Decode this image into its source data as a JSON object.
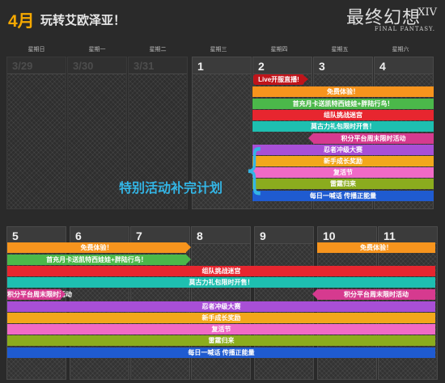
{
  "header": {
    "month": "4月",
    "subtitle": "玩转艾欧泽亚！",
    "logo_main": "最终幻想",
    "logo_numeral": "XIV",
    "logo_sub": "FINAL FANTASY."
  },
  "weekdays": [
    "星期日",
    "星期一",
    "星期二",
    "星期三",
    "星期四",
    "星期五",
    "星期六"
  ],
  "week1_days": [
    "3/29",
    "3/30",
    "3/31",
    "1",
    "2",
    "3",
    "4"
  ],
  "week2_days": [
    "5",
    "6",
    "7",
    "8",
    "9",
    "10",
    "11"
  ],
  "live_tag": "Live开服直播!",
  "plan_label": "特别活动补完计划",
  "events": {
    "free_trial": "免费体验！",
    "first_charge": "首充月卡送凯特西娃娃+胖陆行鸟！",
    "team_maze": "组队挑战迷宫",
    "mogu_gift": "莫古力礼包限时开售！",
    "weekend_points": "积分平台周末限时活动",
    "ninja_contest": "忍者冲级大赛",
    "newbie_reward": "新手成长奖励",
    "resurrection": "复活节",
    "thunder_return": "雷霆归来",
    "daily_shout": "每日一喊话 传播正能量"
  },
  "colors": {
    "orange": "#f7941d",
    "green": "#4bb84a",
    "red": "#e7262f",
    "teal": "#1ebfb0",
    "magenta": "#d63a8f",
    "purple": "#a84fd6",
    "gold": "#f2a71b",
    "pink": "#f06ac6",
    "olive": "#8bac1e",
    "blue": "#1f5bd0",
    "accent_blue": "#33b5e5"
  }
}
